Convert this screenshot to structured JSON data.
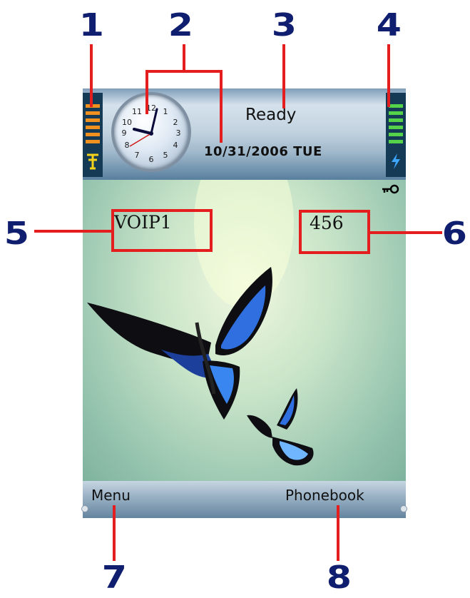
{
  "callouts": [
    "1",
    "2",
    "3",
    "4",
    "5",
    "6",
    "7",
    "8"
  ],
  "status": {
    "ready": "Ready",
    "date": "10/31/2006 TUE"
  },
  "idle": {
    "carrier": "VOIP1",
    "extension": "456"
  },
  "softkeys": {
    "left": "Menu",
    "right": "Phonebook"
  },
  "clock": {
    "numerals": [
      "12",
      "1",
      "2",
      "3",
      "4",
      "5",
      "6",
      "7",
      "8",
      "9",
      "10",
      "11"
    ]
  },
  "icons": {
    "keypad_lock": "key-icon",
    "signal": "signal-strength-icon",
    "antenna": "antenna-icon",
    "battery": "battery-level-icon",
    "charging": "lightning-icon"
  },
  "colors": {
    "callout_number": "#101e70",
    "highlight": "#e41e1e",
    "signal_bars": "#f0901e",
    "battery_bars": "#56d24a"
  }
}
